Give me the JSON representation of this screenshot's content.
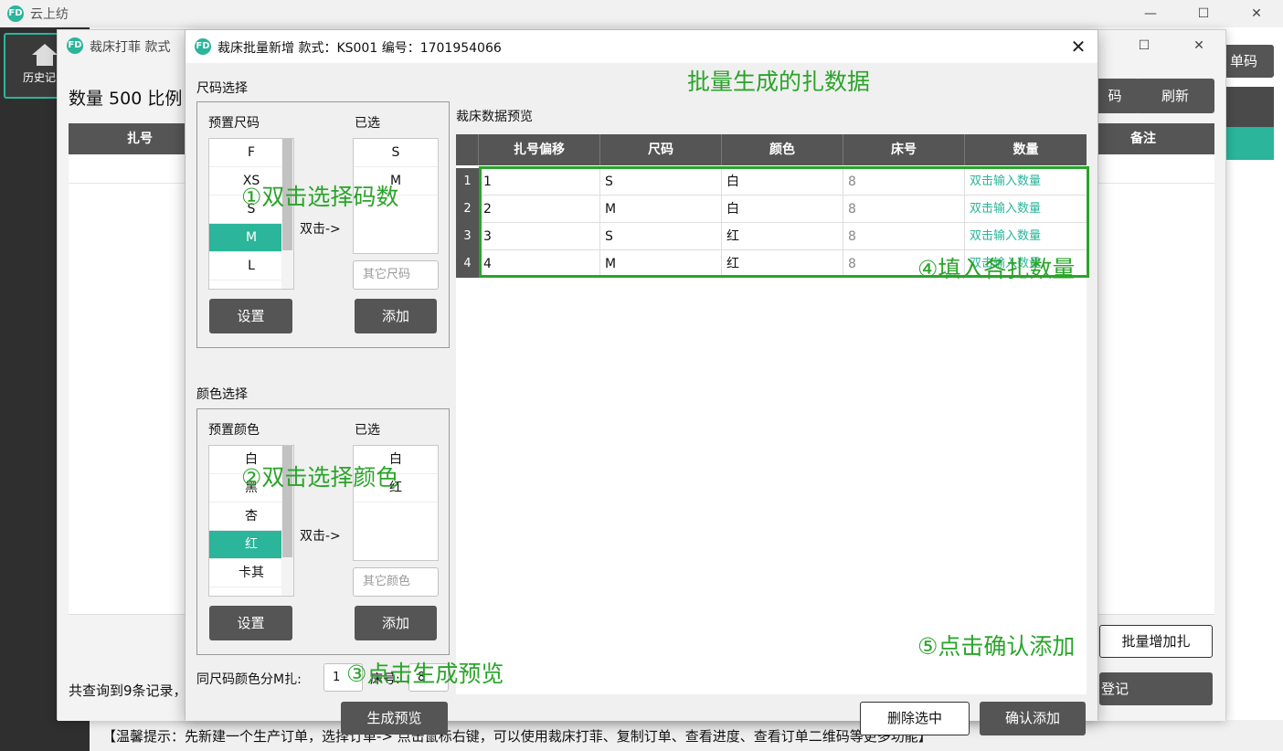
{
  "main_window": {
    "title": "云上纺",
    "logo_text": "FD",
    "nav": {
      "home_label": "历史记录"
    },
    "window_controls": {
      "minimize": "—",
      "maximize": "☐",
      "close": "✕"
    },
    "right_button": "单码",
    "tip": "【温馨提示：先新建一个生产订单，选择订单-> 点击鼠标右键，可以使用裁床打菲、复制订单、查看进度、查看订单二维码等更多功能】"
  },
  "second_window": {
    "title": "裁床打菲   款式",
    "stat": "数量 500   比例",
    "table": {
      "col_first": "扎号",
      "col_last": "备注"
    },
    "buttons": {
      "code": "码",
      "refresh": "刷新",
      "batch_add": "批量增加扎",
      "register": "登记"
    },
    "count_text": "共查询到9条记录，",
    "window_controls": {
      "maximize": "☐",
      "close": "✕"
    }
  },
  "dialog": {
    "title": "裁床批量新增   款式：KS001   编号：1701954066",
    "close": "✕",
    "size_section": {
      "label": "尺码选择",
      "preset_label": "预置尺码",
      "selected_label": "已选",
      "preset_items": [
        "F",
        "XS",
        "S",
        "M",
        "L"
      ],
      "selected_preset": "M",
      "selected_items": [
        "S",
        "M"
      ],
      "double_click_label": "双击->",
      "other_placeholder": "其它尺码",
      "set_button": "设置",
      "add_button": "添加"
    },
    "color_section": {
      "label": "颜色选择",
      "preset_label": "预置颜色",
      "selected_label": "已选",
      "preset_items": [
        "白",
        "黑",
        "杏",
        "红",
        "卡其"
      ],
      "selected_preset": "红",
      "selected_items": [
        "白",
        "红"
      ],
      "double_click_label": "双击->",
      "other_placeholder": "其它颜色",
      "set_button": "设置",
      "add_button": "添加"
    },
    "split": {
      "label": "同尺码颜色分M扎:",
      "value": "1",
      "bed_label": "床号:",
      "bed_value": "8"
    },
    "preview_button": "生成预览",
    "preview": {
      "label": "裁床数据预览",
      "columns": [
        "扎号偏移",
        "尺码",
        "颜色",
        "床号",
        "数量"
      ],
      "rows": [
        {
          "n": "1",
          "offset": "1",
          "size": "S",
          "color": "白",
          "bed": "8",
          "qty": "双击输入数量"
        },
        {
          "n": "2",
          "offset": "2",
          "size": "M",
          "color": "白",
          "bed": "8",
          "qty": "双击输入数量"
        },
        {
          "n": "3",
          "offset": "3",
          "size": "S",
          "color": "红",
          "bed": "8",
          "qty": "双击输入数量"
        },
        {
          "n": "4",
          "offset": "4",
          "size": "M",
          "color": "红",
          "bed": "8",
          "qty": "双击输入数量"
        }
      ]
    },
    "buttons": {
      "delete": "删除选中",
      "confirm": "确认添加"
    }
  },
  "annotations": {
    "batch_title": "批量生成的扎数据",
    "step1": "①双击选择码数",
    "step2": "②双击选择颜色",
    "step3": "③点击生成预览",
    "step4": "④填入各扎数量",
    "step5": "⑤点击确认添加"
  },
  "colors": {
    "accent": "#2bb59a",
    "annotation": "#2aa42a",
    "header": "#555555"
  }
}
